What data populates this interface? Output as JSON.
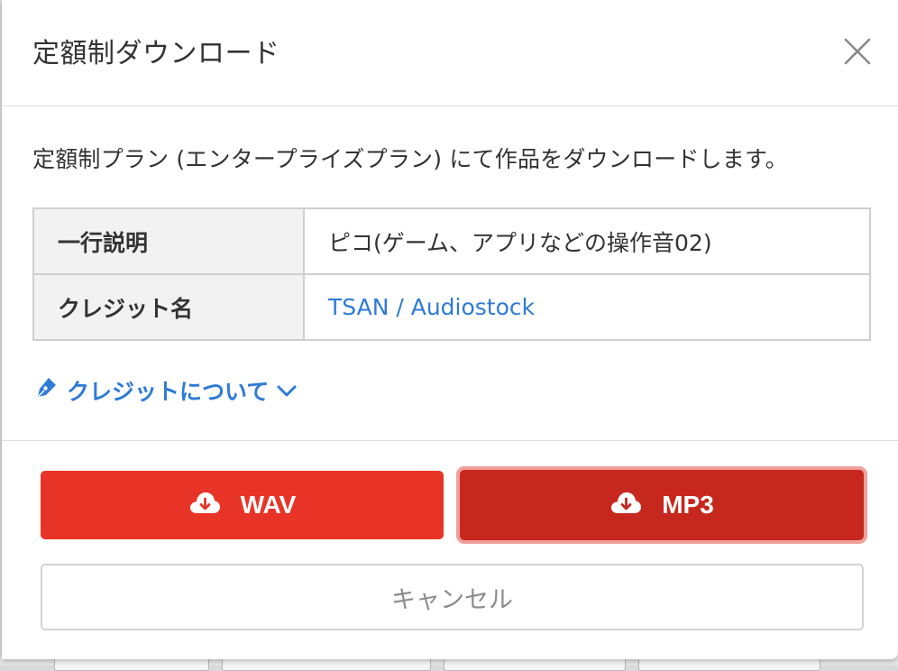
{
  "modal": {
    "title": "定額制ダウンロード",
    "intro": "定額制プラン (エンタープライズプラン) にて作品をダウンロードします。"
  },
  "details": {
    "rows": [
      {
        "label": "一行説明",
        "value": "ピコ(ゲーム、アプリなどの操作音02)"
      },
      {
        "label": "クレジット名",
        "value": "TSAN / Audiostock"
      }
    ]
  },
  "credit_toggle": {
    "label": "クレジットについて",
    "icon": "pen-icon",
    "chevron_icon": "chevron-down-icon"
  },
  "actions": {
    "wav_label": "WAV",
    "mp3_label": "MP3",
    "cancel_label": "キャンセル",
    "download_icon": "cloud-download-icon"
  },
  "colors": {
    "primary_red": "#e83427",
    "active_red": "#c7281d",
    "focus_ring": "#f0a09a",
    "link_blue": "#2e7bd6"
  }
}
